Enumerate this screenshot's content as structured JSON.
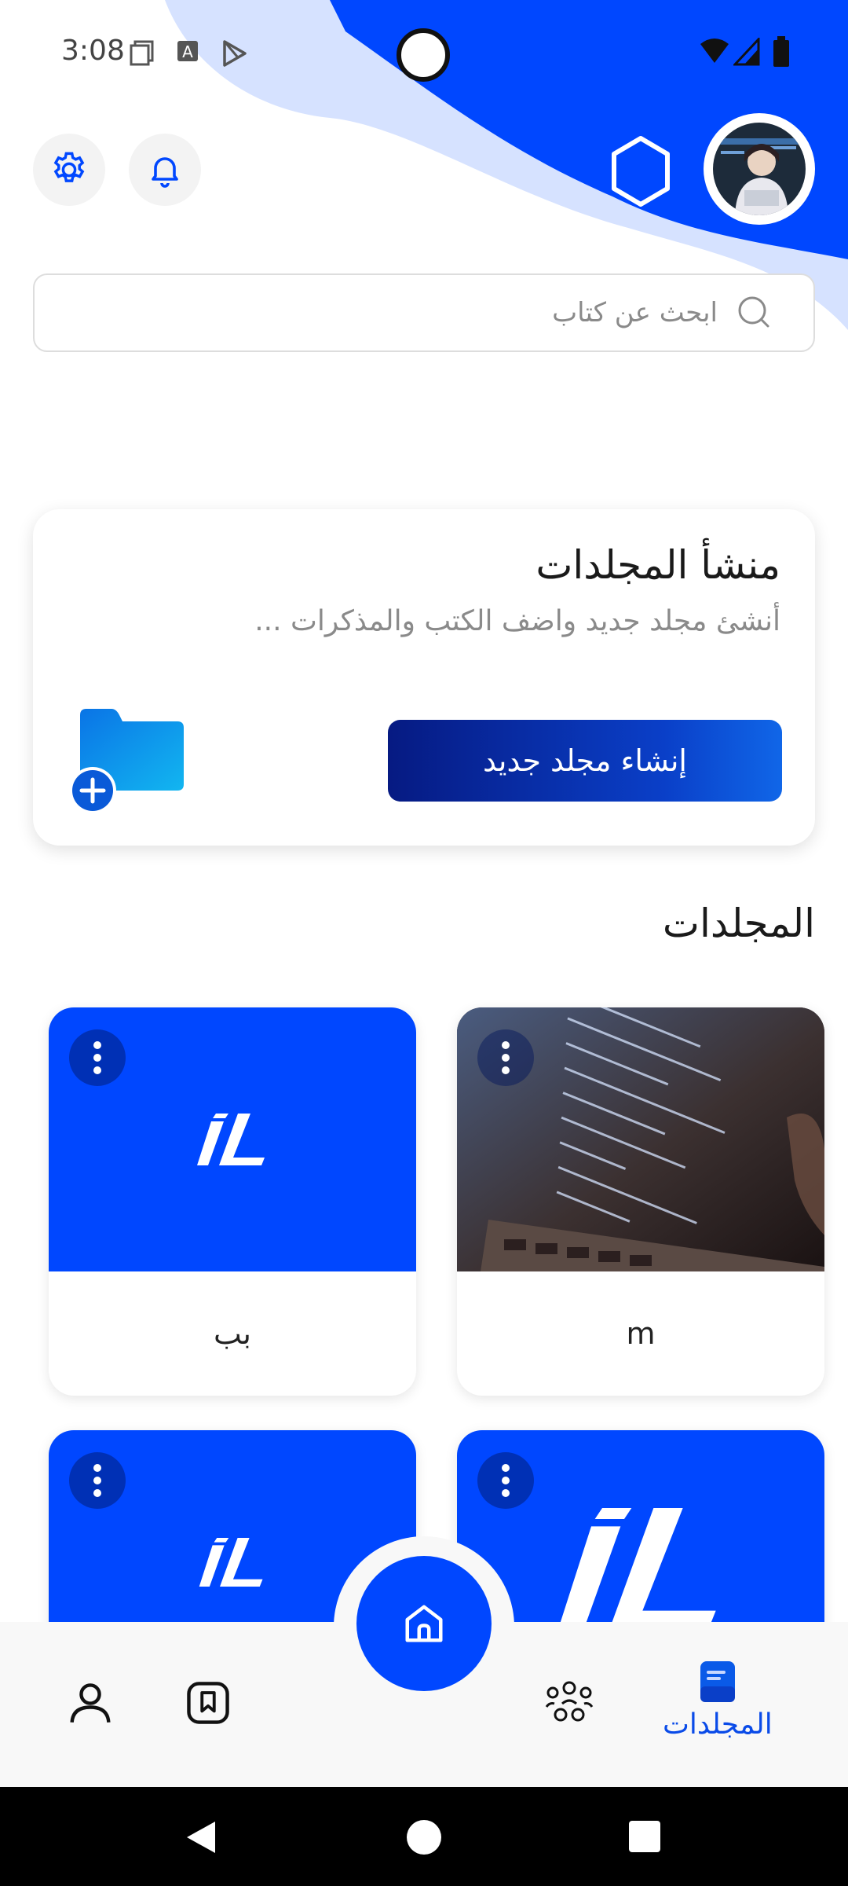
{
  "status_bar": {
    "time": "3:08"
  },
  "search": {
    "placeholder": "ابحث عن كتاب"
  },
  "creator_card": {
    "title": "منشأ المجلدات",
    "subtitle": "أنشئ مجلد جديد واضف الكتب والمذكرات ...",
    "button_label": "إنشاء مجلد جديد"
  },
  "folders_section": {
    "title": "المجلدات",
    "items": [
      {
        "label": "m",
        "cover": "code-photo"
      },
      {
        "label": "بب",
        "cover": "logo"
      },
      {
        "label": "",
        "cover": "logo-large"
      },
      {
        "label": "",
        "cover": "logo"
      }
    ]
  },
  "bottom_nav": {
    "active_label": "المجلدات",
    "items": [
      "folders-icon",
      "community-icon",
      "home-icon",
      "bookmark-icon",
      "profile-icon"
    ]
  },
  "colors": {
    "primary": "#0047ff",
    "accent_light": "#d6e2ff",
    "button_dark": "#061a82"
  }
}
